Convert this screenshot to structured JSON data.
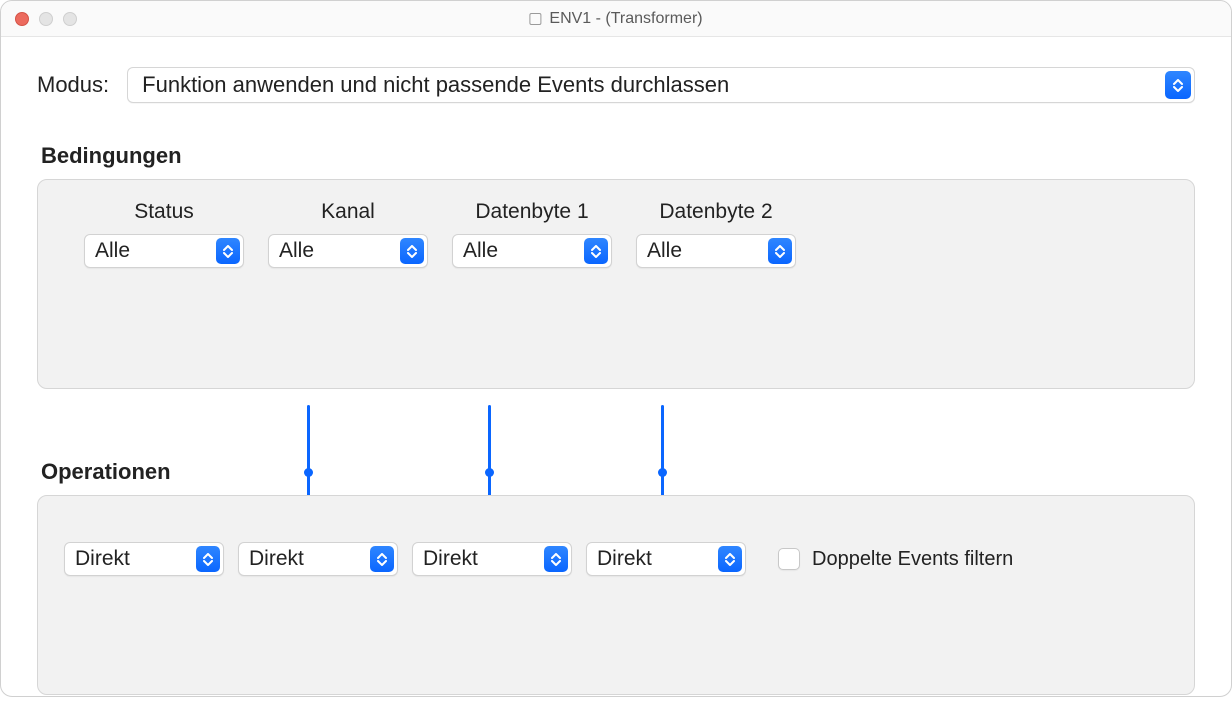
{
  "window": {
    "title": "ENV1 - (Transformer)"
  },
  "modus": {
    "label": "Modus:",
    "value": "Funktion anwenden und nicht passende Events durchlassen"
  },
  "sections": {
    "conditions": "Bedingungen",
    "operations": "Operationen"
  },
  "conditions": {
    "headers": {
      "status": "Status",
      "kanal": "Kanal",
      "db1": "Datenbyte 1",
      "db2": "Datenbyte 2"
    },
    "values": {
      "status": "Alle",
      "kanal": "Alle",
      "db1": "Alle",
      "db2": "Alle"
    }
  },
  "operations": {
    "values": {
      "op1": "Direkt",
      "op2": "Direkt",
      "op3": "Direkt",
      "op4": "Direkt"
    },
    "filter_label": "Doppelte Events filtern",
    "filter_checked": false
  }
}
